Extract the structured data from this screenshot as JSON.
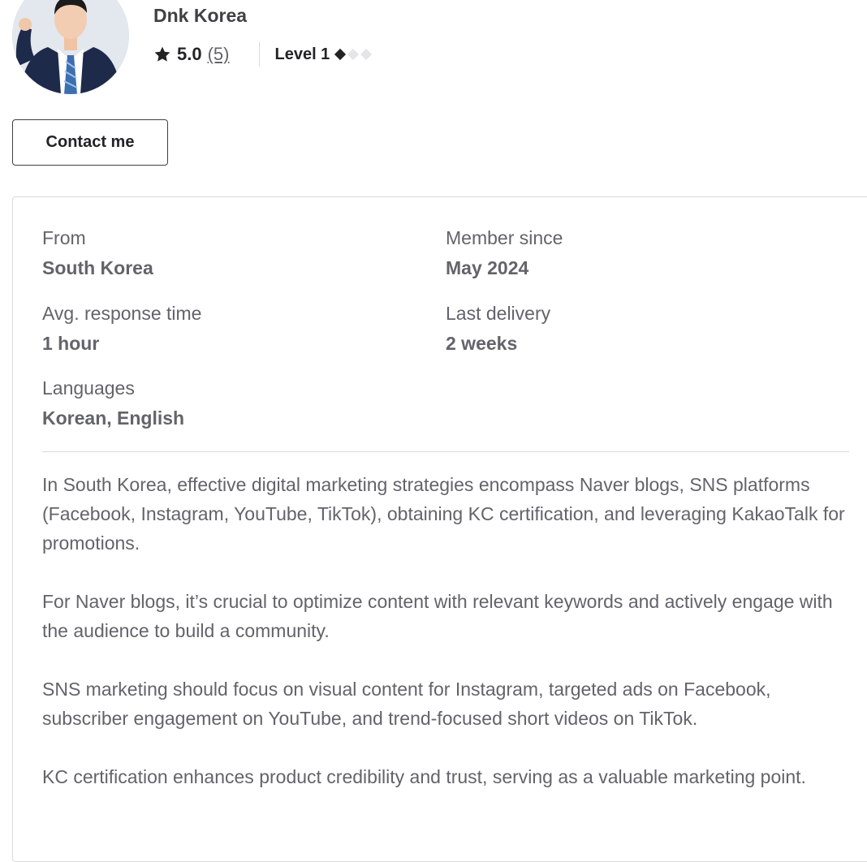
{
  "profile": {
    "name": "Dnk Korea",
    "rating": "5.0",
    "review_count": "(5)",
    "level_label": "Level 1",
    "level_filled": 1,
    "level_total": 3,
    "icons": {
      "rating": "star-icon",
      "level": "diamond-icon"
    }
  },
  "contact_label": "Contact me",
  "info": {
    "from_label": "From",
    "from_value": "South Korea",
    "member_label": "Member since",
    "member_value": "May 2024",
    "response_label": "Avg. response time",
    "response_value": "1 hour",
    "delivery_label": "Last delivery",
    "delivery_value": "2 weeks",
    "languages_label": "Languages",
    "languages_value": "Korean, English"
  },
  "description": [
    "In South Korea, effective digital marketing strategies encompass Naver blogs, SNS platforms (Facebook, Instagram, YouTube, TikTok), obtaining KC certification, and leveraging KakaoTalk for promotions.",
    "For Naver blogs, it’s crucial to optimize content with relevant keywords and actively engage with the audience to build a community.",
    "SNS marketing should focus on visual content for Instagram, targeted ads on Facebook, subscriber engagement on YouTube, and trend-focused short videos on TikTok.",
    "KC certification enhances product credibility and trust, serving as a valuable marketing point."
  ],
  "colors": {
    "text_dark": "#222325",
    "text_muted": "#62646a",
    "border": "#dadbdd"
  }
}
